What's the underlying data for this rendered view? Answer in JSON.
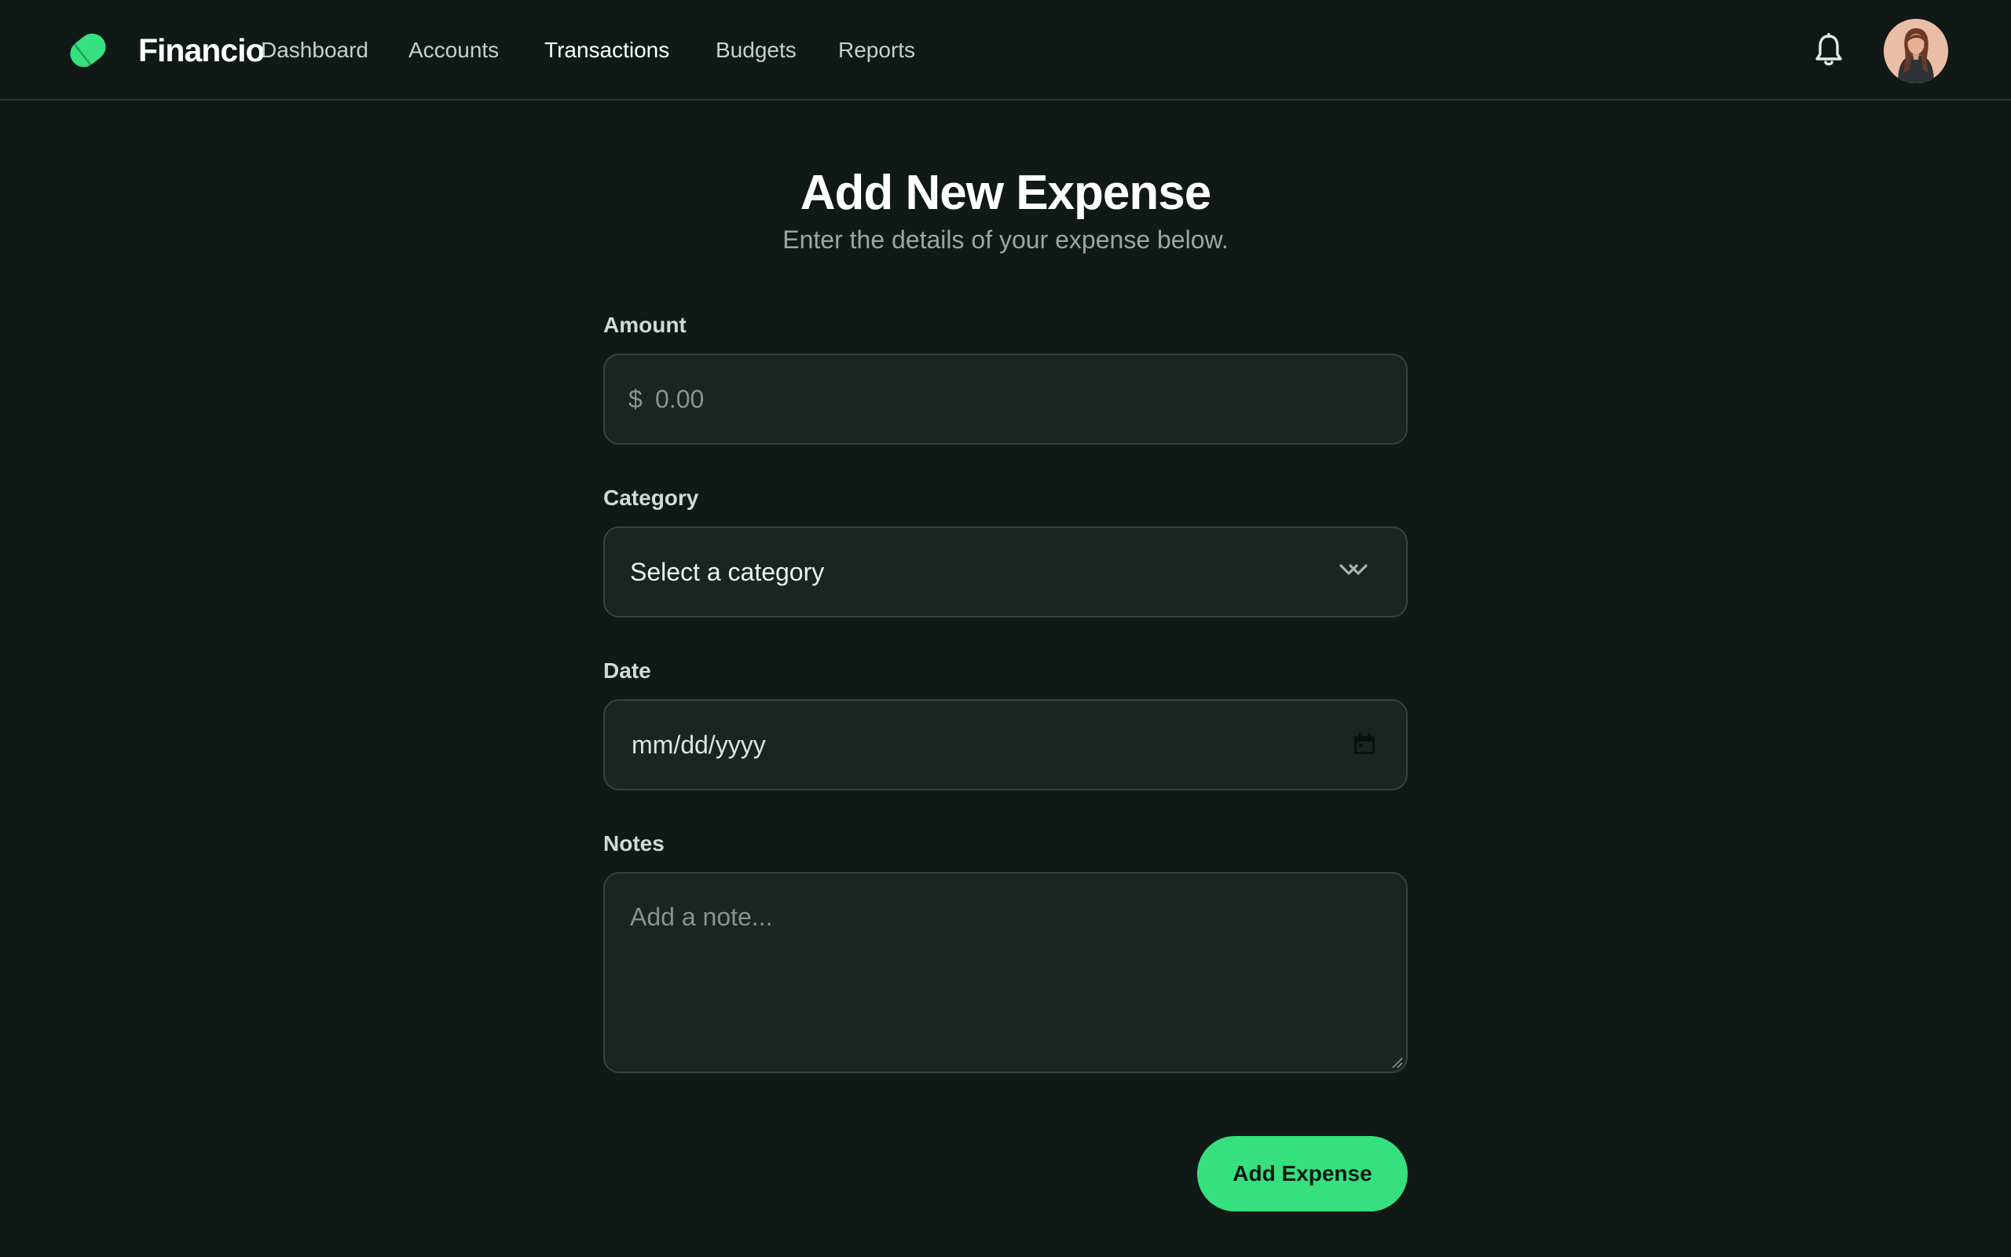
{
  "brand": {
    "name": "Financio",
    "accent_color": "#36e07e"
  },
  "nav": {
    "items": [
      {
        "label": "Dashboard",
        "active": false
      },
      {
        "label": "Accounts",
        "active": false
      },
      {
        "label": "Transactions",
        "active": true
      },
      {
        "label": "Budgets",
        "active": false
      },
      {
        "label": "Reports",
        "active": false
      }
    ]
  },
  "header": {
    "notifications_icon": "bell-icon",
    "avatar_icon": "user-avatar"
  },
  "page": {
    "title": "Add New Expense",
    "subtitle": "Enter the details of your expense below."
  },
  "form": {
    "amount": {
      "label": "Amount",
      "currency_symbol": "$",
      "placeholder": "0.00",
      "value": ""
    },
    "category": {
      "label": "Category",
      "selected": "Select a category",
      "icon": "chevron-down-icon"
    },
    "date": {
      "label": "Date",
      "placeholder": "mm/dd/yyyy",
      "icon": "calendar-icon"
    },
    "notes": {
      "label": "Notes",
      "placeholder": "Add a note..."
    },
    "submit_label": "Add Expense"
  },
  "colors": {
    "background": "#111917",
    "field_background": "#1b2421",
    "field_border": "#36433f",
    "accent": "#36e07e"
  }
}
